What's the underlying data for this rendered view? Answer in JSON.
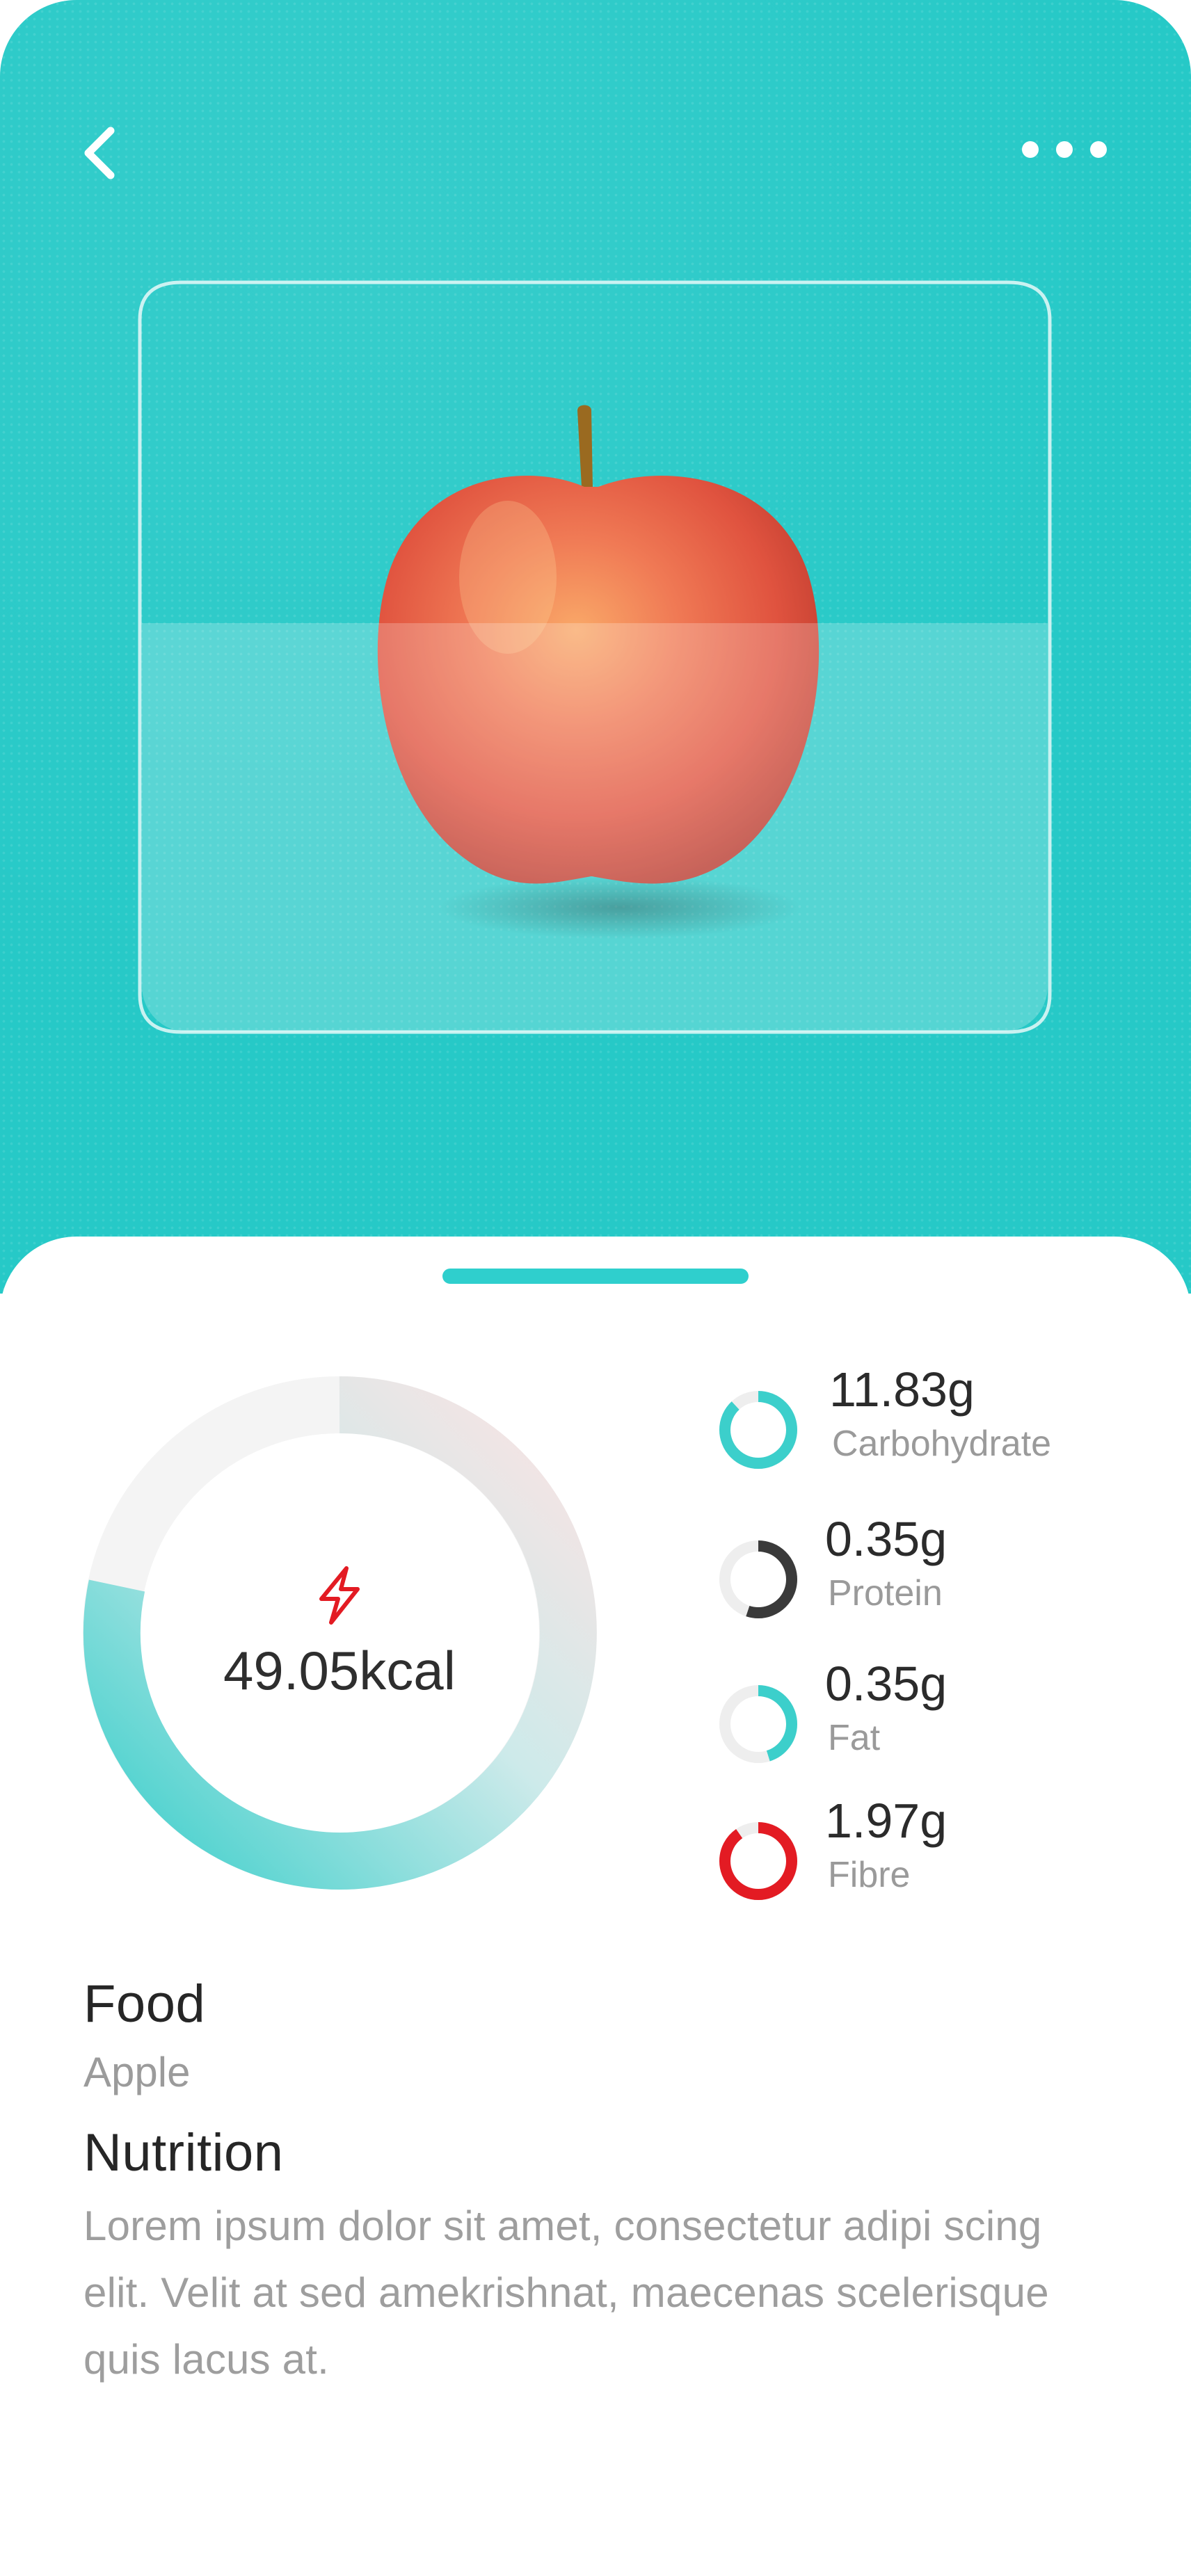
{
  "header": {
    "back_icon": "chevron-left-icon",
    "more_icon": "more-horizontal-icon"
  },
  "hero": {
    "background_color": "#26c9c7",
    "image": "apple"
  },
  "calories": {
    "icon": "lightning-icon",
    "value": "49.05kcal",
    "accent_color": "#e31b23"
  },
  "nutrients": [
    {
      "value": "11.83g",
      "label": "Carbohydrate",
      "color": "#3ccfcb",
      "level": 0.88
    },
    {
      "value": "0.35g",
      "label": "Protein",
      "color": "#3a3a3a",
      "level": 0.55
    },
    {
      "value": "0.35g",
      "label": "Fat",
      "color": "#3ccfcb",
      "level": 0.45
    },
    {
      "value": "1.97g",
      "label": "Fibre",
      "color": "#e31b23",
      "level": 0.9
    }
  ],
  "details": {
    "food_heading": "Food",
    "food_value": "Apple",
    "nutrition_heading": "Nutrition",
    "nutrition_text": "Lorem ipsum dolor sit amet, consectetur adipi scing elit. Velit at sed amekrishnat, maecenas scelerisque quis lacus at."
  }
}
